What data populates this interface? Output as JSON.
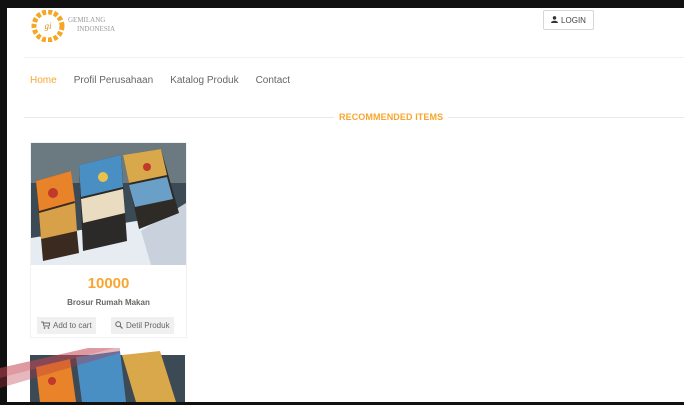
{
  "brand": {
    "line1": "GEMILANG",
    "line2": "INDONESIA",
    "logo_text": "GEMILANG INDONESIA"
  },
  "header": {
    "login_label": "LOGIN",
    "login_icon": "user-icon"
  },
  "nav": [
    {
      "label": "Home",
      "active": true
    },
    {
      "label": "Profil Perusahaan",
      "active": false
    },
    {
      "label": "Katalog Produk",
      "active": false
    },
    {
      "label": "Contact",
      "active": false
    }
  ],
  "section": {
    "title": "RECOMMENDED ITEMS"
  },
  "products": [
    {
      "price": "10000",
      "name": "Brosur Rumah Makan",
      "cart_label": "Add to cart",
      "detail_label": "Detil Produk"
    }
  ],
  "colors": {
    "accent": "#f8a630",
    "text": "#696763",
    "button_bg": "#f0f0f0"
  }
}
